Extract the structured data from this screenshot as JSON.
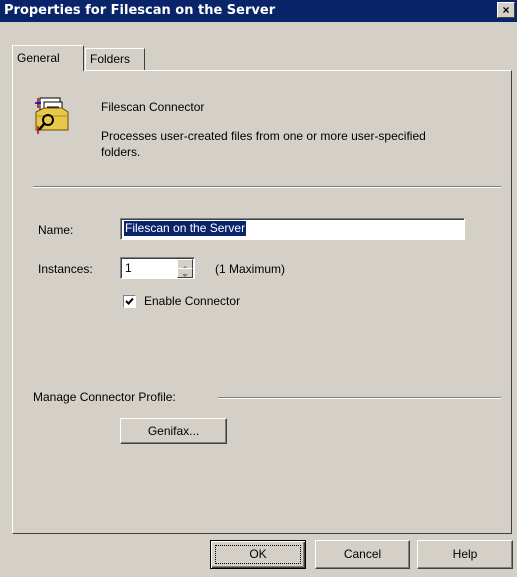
{
  "window": {
    "title": "Properties for Filescan on the Server",
    "close_glyph": "×"
  },
  "tabs": [
    {
      "label": "General",
      "active": true
    },
    {
      "label": "Folders",
      "active": false
    }
  ],
  "connector": {
    "icon": "filescan-connector-icon",
    "name": "Filescan Connector",
    "description_line1": "Processes user-created files from one or more user-specified",
    "description_line2": "folders."
  },
  "form": {
    "name_label": "Name:",
    "name_value": "Filescan on the Server",
    "instances_label": "Instances:",
    "instances_value": "1",
    "instances_max": "(1 Maximum)",
    "enable_label": "Enable Connector",
    "enable_checked": true
  },
  "profile": {
    "group_label": "Manage Connector Profile:",
    "button_label": "Genifax..."
  },
  "footer": {
    "ok_label": "OK",
    "cancel_label": "Cancel",
    "help_label": "Help"
  },
  "colors": {
    "titlebar": "#0a246a",
    "face": "#d4d0c8",
    "selection": "#0a246a"
  }
}
